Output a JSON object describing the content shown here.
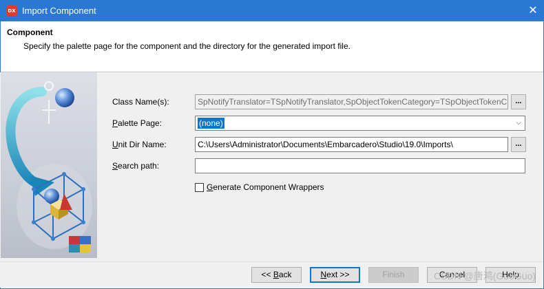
{
  "window": {
    "title": "Import Component",
    "app_icon_text": "DX",
    "close_glyph": "✕"
  },
  "header": {
    "title": "Component",
    "description": "Specify the palette page for the component and the directory for the generated import file."
  },
  "form": {
    "class_names": {
      "label_pre": "Class Name",
      "label_underline": "",
      "label_post": "(s):",
      "value": "SpNotifyTranslator=TSpNotifyTranslator,SpObjectTokenCategory=TSpObjectTokenCategory",
      "button": "..."
    },
    "palette_page": {
      "label_pre": "",
      "label_underline": "P",
      "label_post": "alette Page:",
      "value": "(none)",
      "chevron": "⌵"
    },
    "unit_dir": {
      "label_pre": "",
      "label_underline": "U",
      "label_post": "nit Dir Name:",
      "value": "C:\\Users\\Administrator\\Documents\\Embarcadero\\Studio\\19.0\\Imports\\",
      "button": "..."
    },
    "search_path": {
      "label_pre": "",
      "label_underline": "S",
      "label_post": "earch path:",
      "value": ""
    },
    "generate_wrappers": {
      "label_pre": "",
      "label_underline": "G",
      "label_post": "enerate Component Wrappers",
      "checked": false
    }
  },
  "footer": {
    "back_pre": "<< ",
    "back_underline": "B",
    "back_post": "ack",
    "next_pre": "",
    "next_underline": "N",
    "next_post": "ext >>",
    "finish": "Finish",
    "cancel": "Cancel",
    "help": "Help"
  },
  "watermark": "CSDN @唐鸿(GuoGuo)",
  "colors": {
    "titlebar": "#2b78d4",
    "selection": "#0078d7",
    "dialog_bg": "#f0f0f0"
  }
}
